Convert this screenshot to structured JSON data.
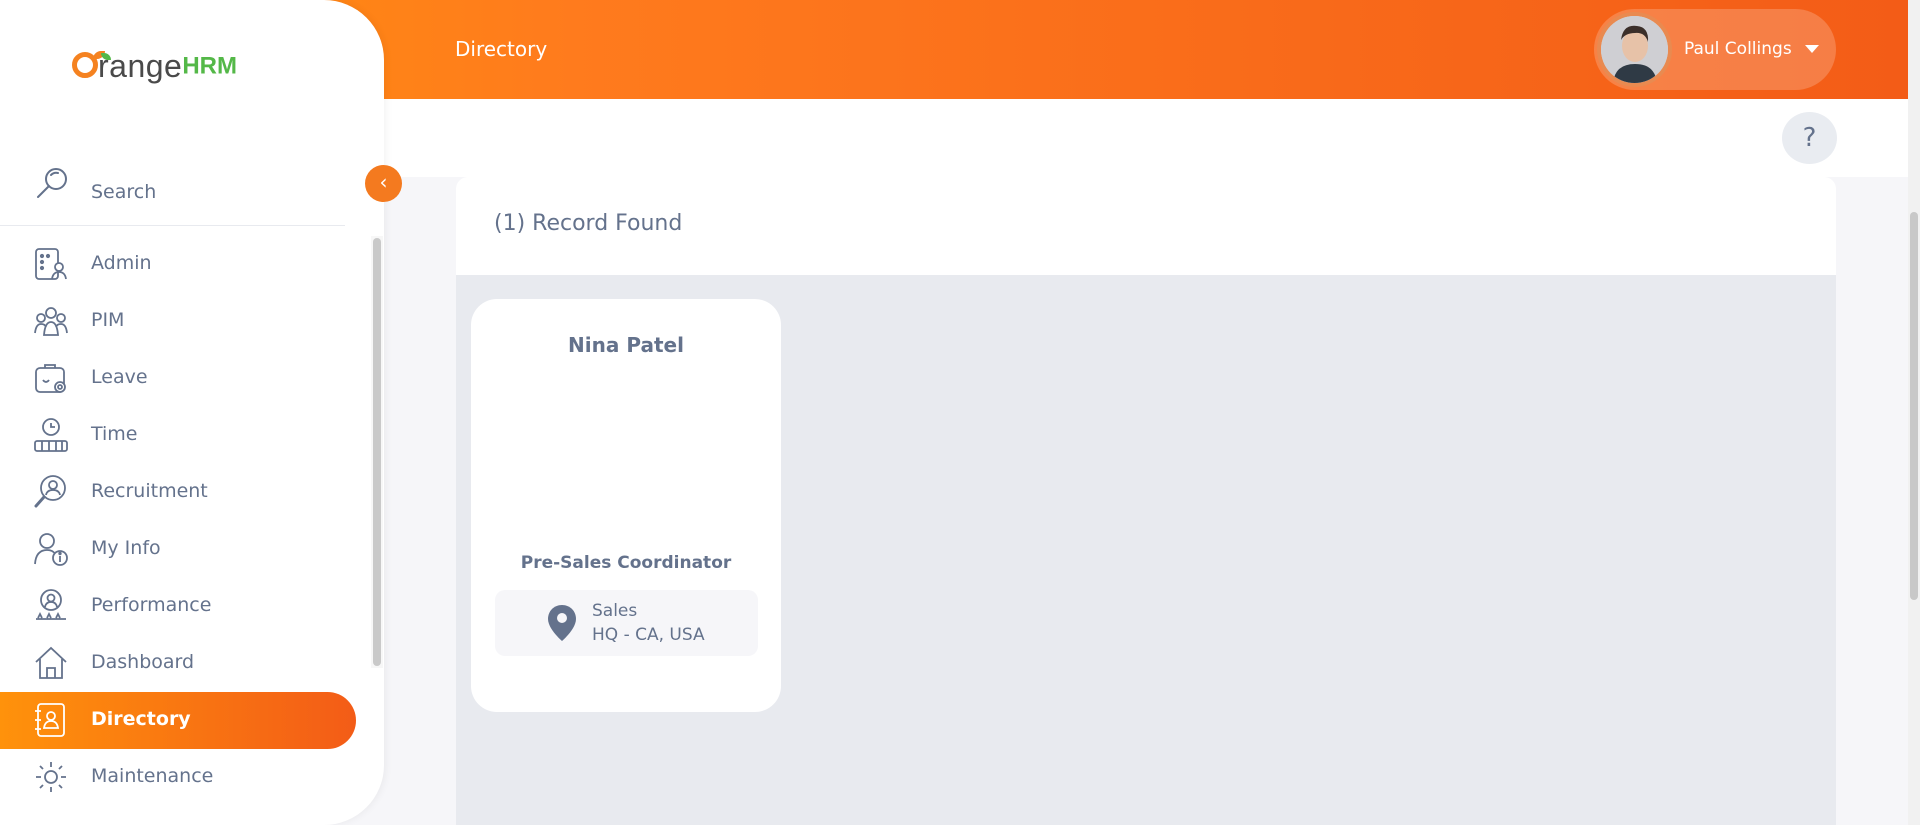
{
  "header": {
    "page_title": "Directory",
    "user_name": "Paul Collings",
    "help_label": "?"
  },
  "sidebar": {
    "logo_text": "range",
    "logo_suffix": "HRM",
    "search_label": "Search",
    "items": [
      {
        "label": "Admin",
        "icon": "admin-icon"
      },
      {
        "label": "PIM",
        "icon": "pim-icon"
      },
      {
        "label": "Leave",
        "icon": "leave-icon"
      },
      {
        "label": "Time",
        "icon": "time-icon"
      },
      {
        "label": "Recruitment",
        "icon": "recruitment-icon"
      },
      {
        "label": "My Info",
        "icon": "my-info-icon"
      },
      {
        "label": "Performance",
        "icon": "performance-icon"
      },
      {
        "label": "Dashboard",
        "icon": "dashboard-icon"
      },
      {
        "label": "Directory",
        "icon": "directory-icon",
        "active": true
      },
      {
        "label": "Maintenance",
        "icon": "maintenance-icon"
      }
    ],
    "collapse_glyph": "‹"
  },
  "main": {
    "records_found": "(1) Record Found",
    "cards": [
      {
        "name": "Nina Patel",
        "job_title": "Pre-Sales Coordinator",
        "sub_unit": "Sales",
        "location": "HQ - CA, USA"
      }
    ]
  },
  "colors": {
    "brand_orange": "#ff7b1d",
    "brand_orange_dark": "#f35c17",
    "text_muted": "#64728c",
    "content_bg": "#e8eaef"
  }
}
